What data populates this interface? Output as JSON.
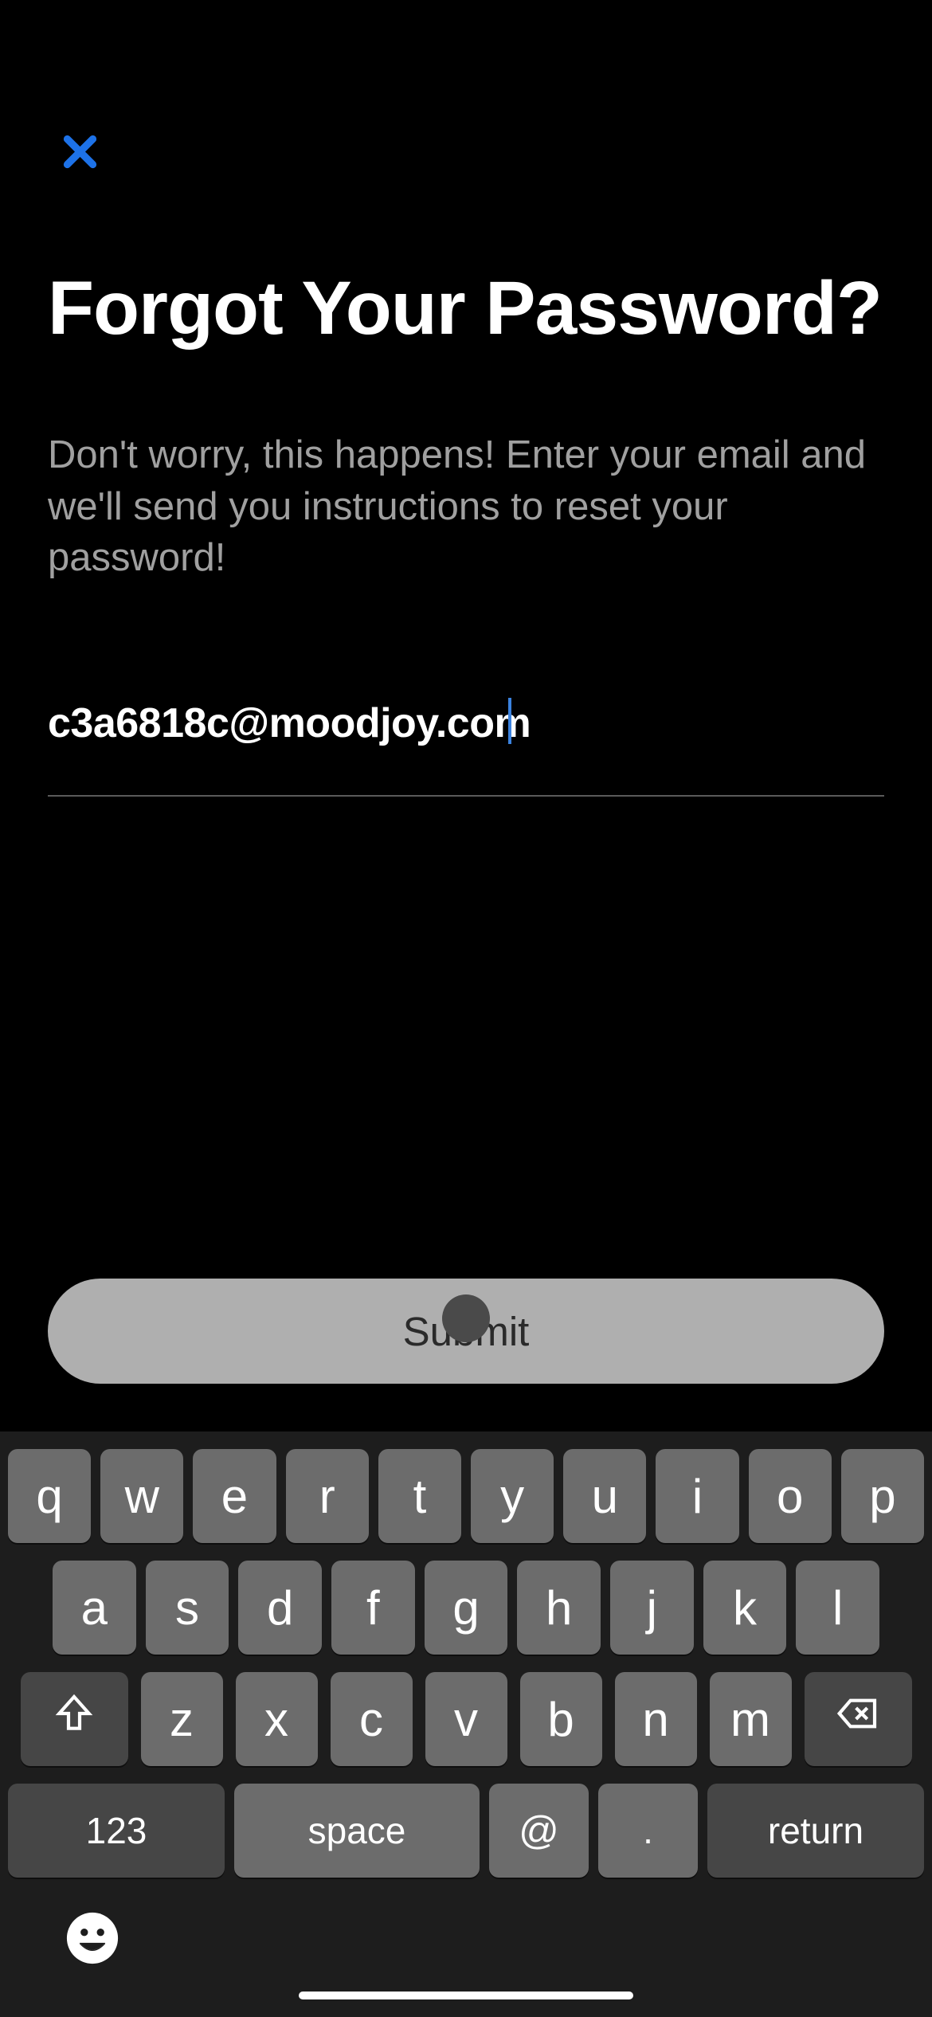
{
  "header": {
    "close_icon": "close"
  },
  "page": {
    "title": "Forgot Your Password?",
    "subtitle": "Don't worry, this happens! Enter your email and we'll send you instructions to reset your password!"
  },
  "form": {
    "email_value": "c3a6818c@moodjoy.com",
    "submit_label": "Submit"
  },
  "keyboard": {
    "row1": [
      "q",
      "w",
      "e",
      "r",
      "t",
      "y",
      "u",
      "i",
      "o",
      "p"
    ],
    "row2": [
      "a",
      "s",
      "d",
      "f",
      "g",
      "h",
      "j",
      "k",
      "l"
    ],
    "row3": [
      "z",
      "x",
      "c",
      "v",
      "b",
      "n",
      "m"
    ],
    "numbers_label": "123",
    "space_label": "space",
    "at_label": "@",
    "dot_label": ".",
    "return_label": "return"
  }
}
